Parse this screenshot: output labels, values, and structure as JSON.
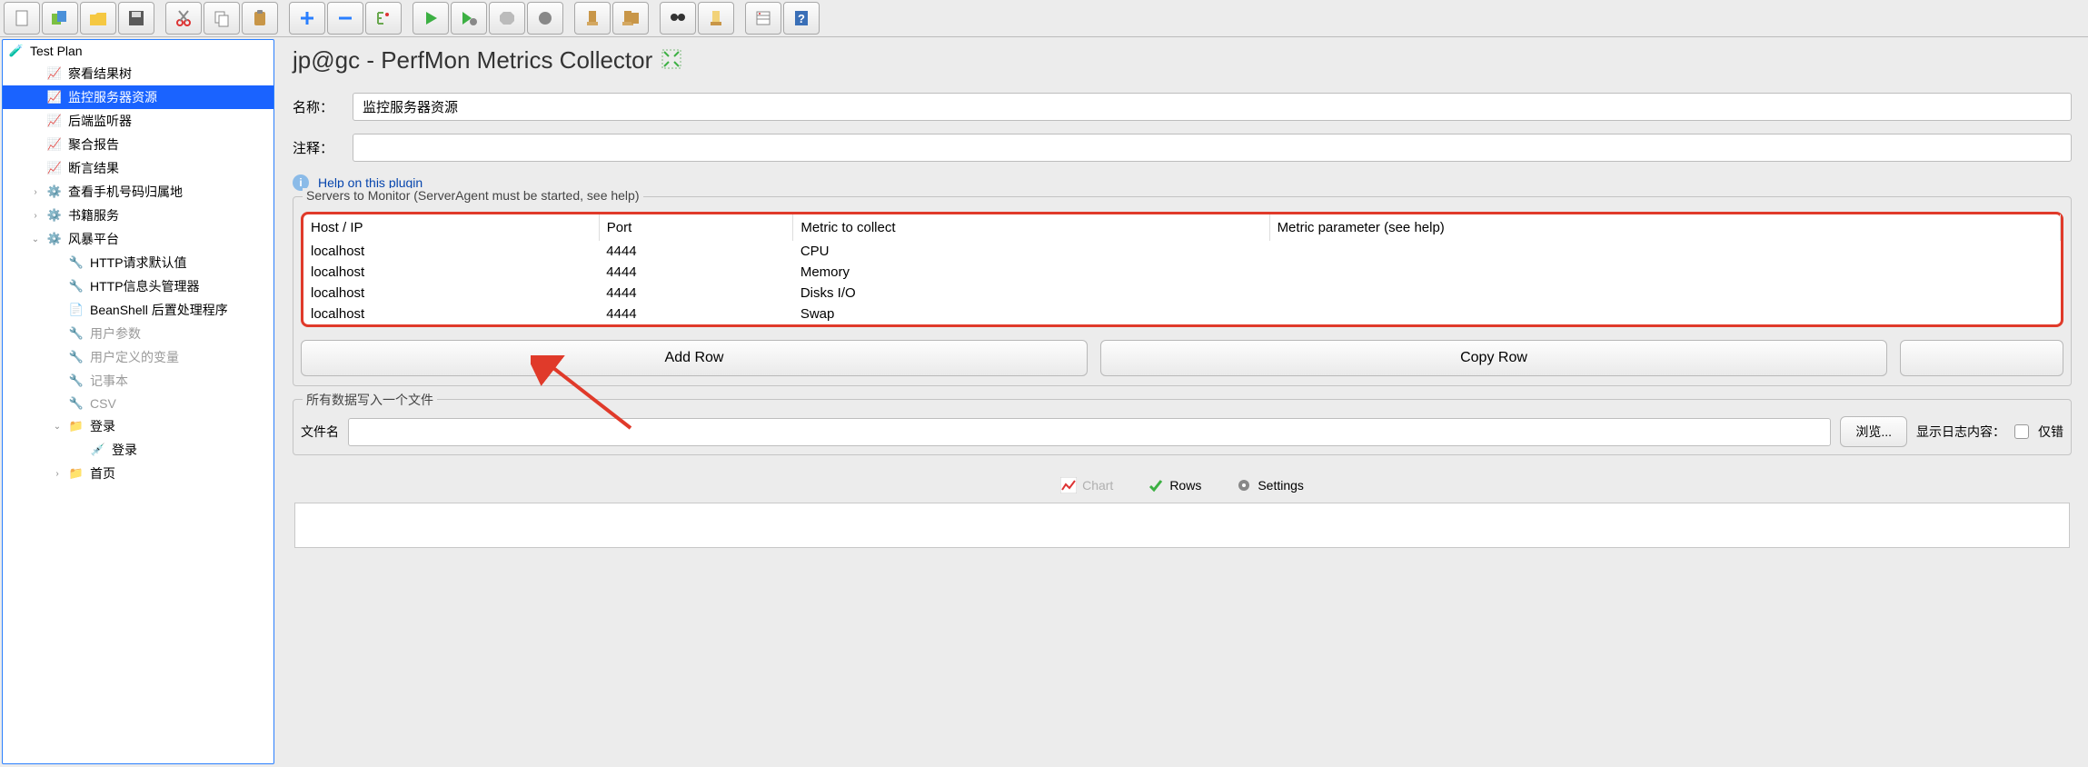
{
  "toolbar_icons": [
    "file-new",
    "file-templates",
    "file-open",
    "file-save",
    "sep",
    "cut",
    "copy",
    "paste",
    "sep",
    "add",
    "remove",
    "expand",
    "sep",
    "run",
    "run-no-timers",
    "stop",
    "shutdown",
    "sep",
    "clear",
    "clear-all",
    "sep",
    "search",
    "function-helper",
    "sep",
    "options",
    "help"
  ],
  "tree": {
    "root": {
      "label": "Test Plan",
      "icon": "flask"
    },
    "items": [
      {
        "label": "察看结果树",
        "icon": "chart",
        "indent": 1
      },
      {
        "label": "监控服务器资源",
        "icon": "chart",
        "indent": 1,
        "selected": true
      },
      {
        "label": "后端监听器",
        "icon": "chart",
        "indent": 1
      },
      {
        "label": "聚合报告",
        "icon": "chart",
        "indent": 1
      },
      {
        "label": "断言结果",
        "icon": "chart",
        "indent": 1
      },
      {
        "label": "查看手机号码归属地",
        "icon": "gear",
        "indent": 1,
        "expander": ">"
      },
      {
        "label": "书籍服务",
        "icon": "gear",
        "indent": 1,
        "expander": ">"
      },
      {
        "label": "风暴平台",
        "icon": "gear",
        "indent": 1,
        "expander": "v"
      },
      {
        "label": "HTTP请求默认值",
        "icon": "wrench",
        "indent": 2
      },
      {
        "label": "HTTP信息头管理器",
        "icon": "wrench",
        "indent": 2
      },
      {
        "label": "BeanShell 后置处理程序",
        "icon": "bean",
        "indent": 2
      },
      {
        "label": "用户参数",
        "icon": "wrench",
        "indent": 2,
        "disabled": true
      },
      {
        "label": "用户定义的变量",
        "icon": "wrench",
        "indent": 2,
        "disabled": true
      },
      {
        "label": "记事本",
        "icon": "wrench",
        "indent": 2,
        "disabled": true
      },
      {
        "label": "CSV",
        "icon": "wrench",
        "indent": 2,
        "disabled": true
      },
      {
        "label": "登录",
        "icon": "folder",
        "indent": 2,
        "expander": "v"
      },
      {
        "label": "登录",
        "icon": "dropper",
        "indent": 3
      },
      {
        "label": "首页",
        "icon": "folder",
        "indent": 2,
        "expander": ">"
      }
    ]
  },
  "panel": {
    "title": "jp@gc - PerfMon Metrics Collector",
    "name_label": "名称：",
    "name_value": "监控服务器资源",
    "comment_label": "注释：",
    "comment_value": "",
    "help_text": "Help on this plugin",
    "servers_legend": "Servers to Monitor (ServerAgent must be started, see help)",
    "table": {
      "headers": [
        "Host / IP",
        "Port",
        "Metric to collect",
        "Metric parameter (see help)"
      ],
      "rows": [
        {
          "host": "localhost",
          "port": "4444",
          "metric": "CPU",
          "param": ""
        },
        {
          "host": "localhost",
          "port": "4444",
          "metric": "Memory",
          "param": ""
        },
        {
          "host": "localhost",
          "port": "4444",
          "metric": "Disks I/O",
          "param": ""
        },
        {
          "host": "localhost",
          "port": "4444",
          "metric": "Swap",
          "param": ""
        }
      ]
    },
    "buttons": {
      "add": "Add Row",
      "copy": "Copy Row"
    },
    "file_legend": "所有数据写入一个文件",
    "filename_label": "文件名",
    "browse": "浏览...",
    "log_label": "显示日志内容：",
    "only_errors": "仅错",
    "tabs": {
      "chart": "Chart",
      "rows": "Rows",
      "settings": "Settings"
    }
  }
}
